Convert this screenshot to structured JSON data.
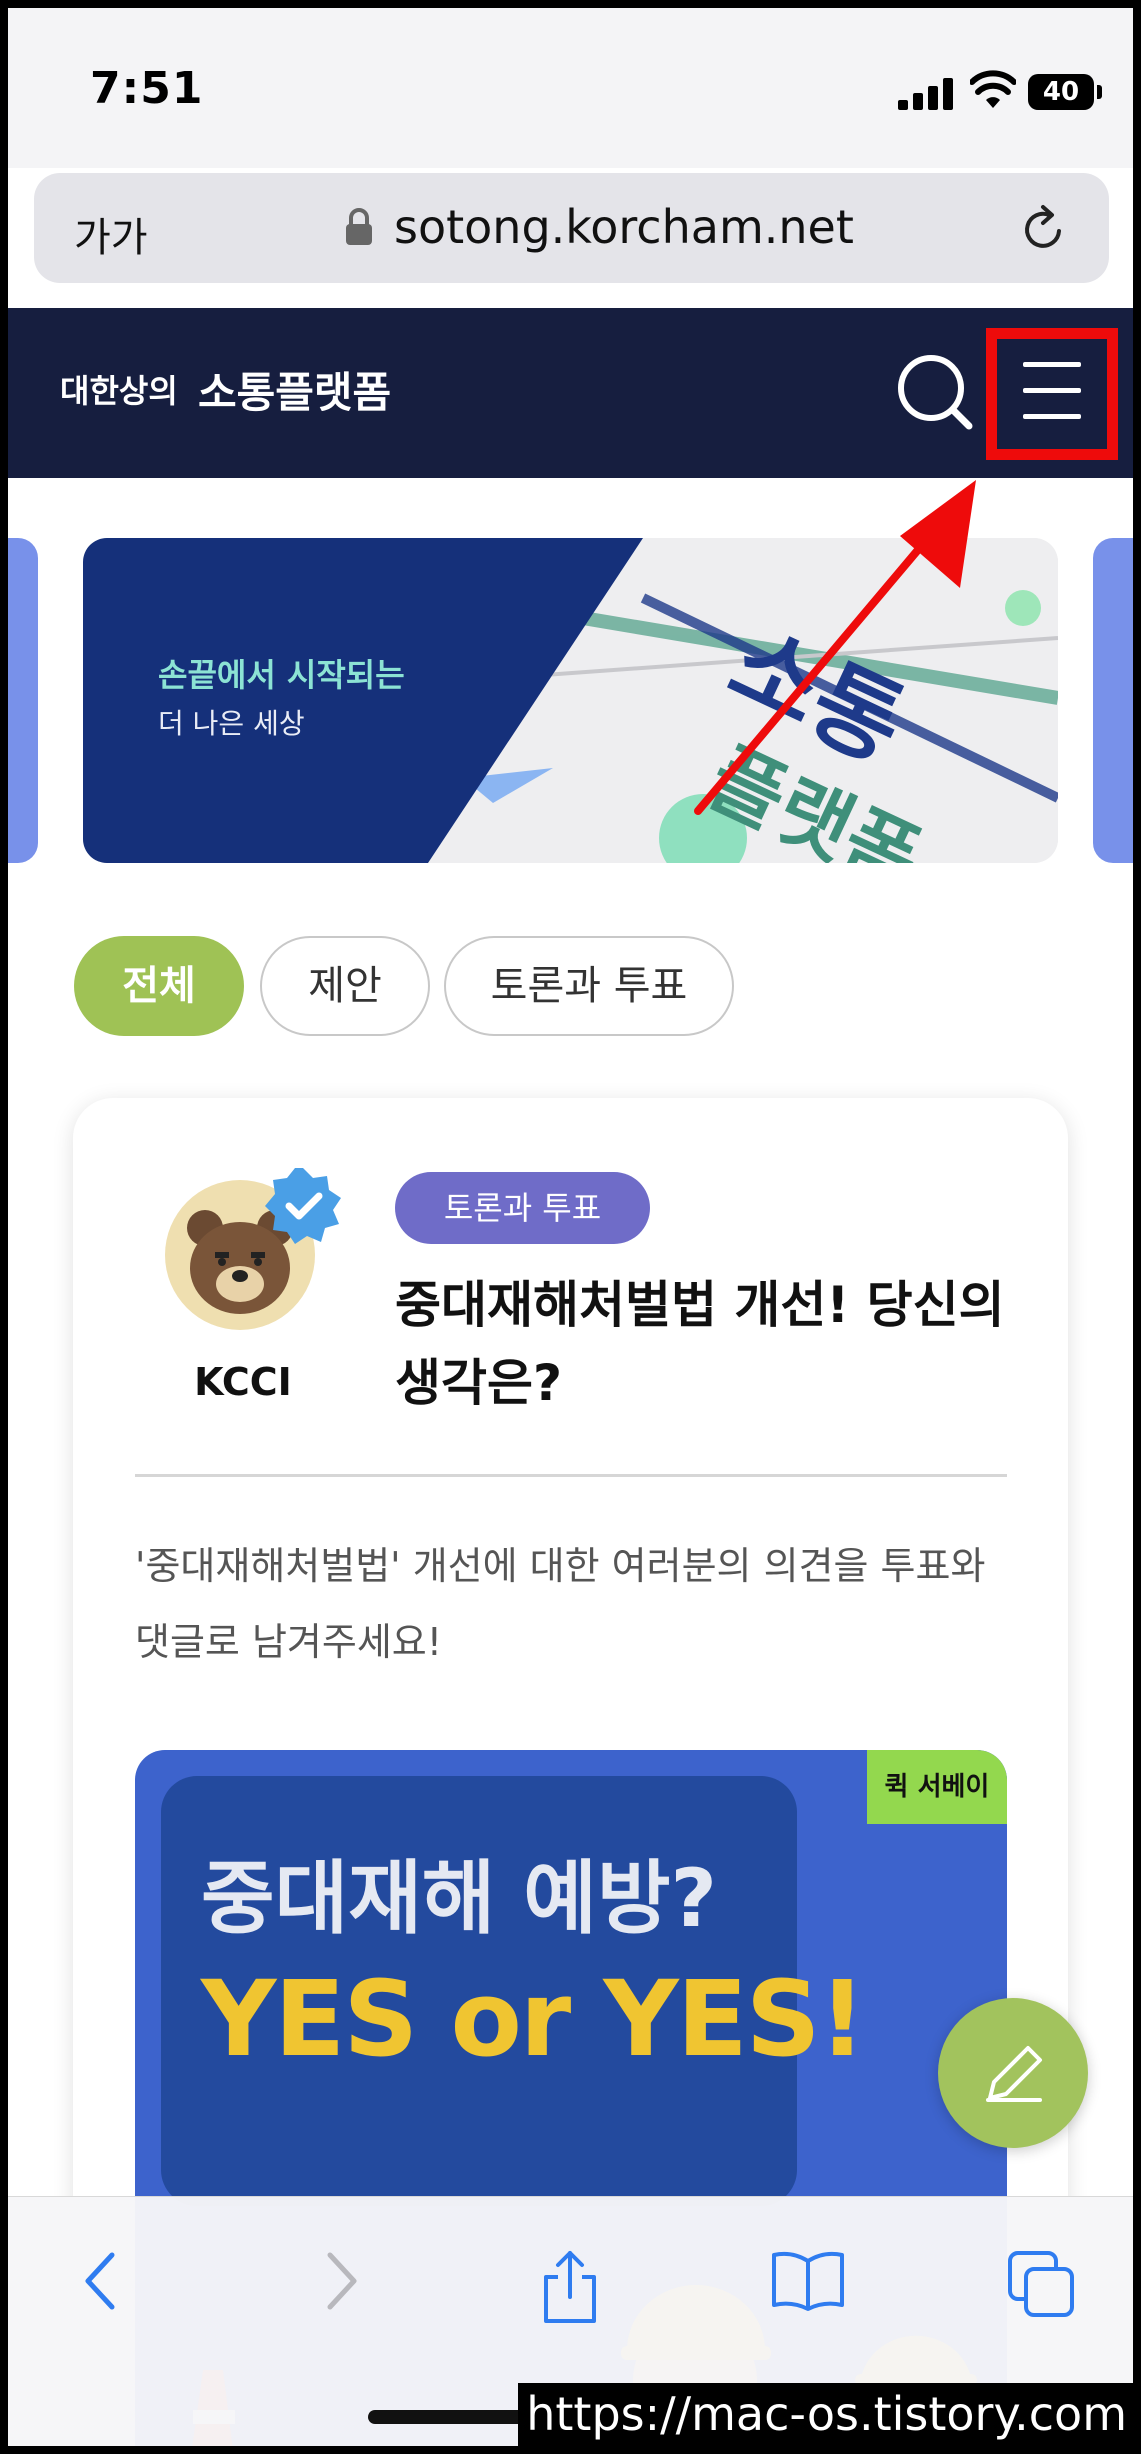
{
  "status_bar": {
    "time": "7:51",
    "battery": "40"
  },
  "browser": {
    "text_size_label": "가가",
    "url": "sotong.korcham.net"
  },
  "site_header": {
    "brand_small": "대한상의",
    "brand_big": "소통플랫폼"
  },
  "banner": {
    "title": "손끝에서 시작되는",
    "subtitle": "더 나은 세상",
    "art_text_1": "소통",
    "art_text_2": "플랫폼"
  },
  "filters": {
    "all": "전체",
    "proposal": "제안",
    "debate": "토론과 투표",
    "selected": "전체"
  },
  "post": {
    "author": "KCCI",
    "tag": "토론과 투표",
    "title": "중대재해처벌법 개선! 당신의 생각은?",
    "body": "'중대재해처벌법' 개선에 대한 여러분의 의견을 투표와 댓글로 남겨주세요!",
    "image": {
      "badge": "퀵 서베이",
      "headline": "중대재해 예방?",
      "headline2": "YES or YES!"
    }
  },
  "watermark": "https://mac-os.tistory.com",
  "colors": {
    "header_bg": "#161e3f",
    "accent_green": "#9fc255",
    "tag_purple": "#6f6cc8",
    "highlight_red": "#ee0b0b"
  }
}
